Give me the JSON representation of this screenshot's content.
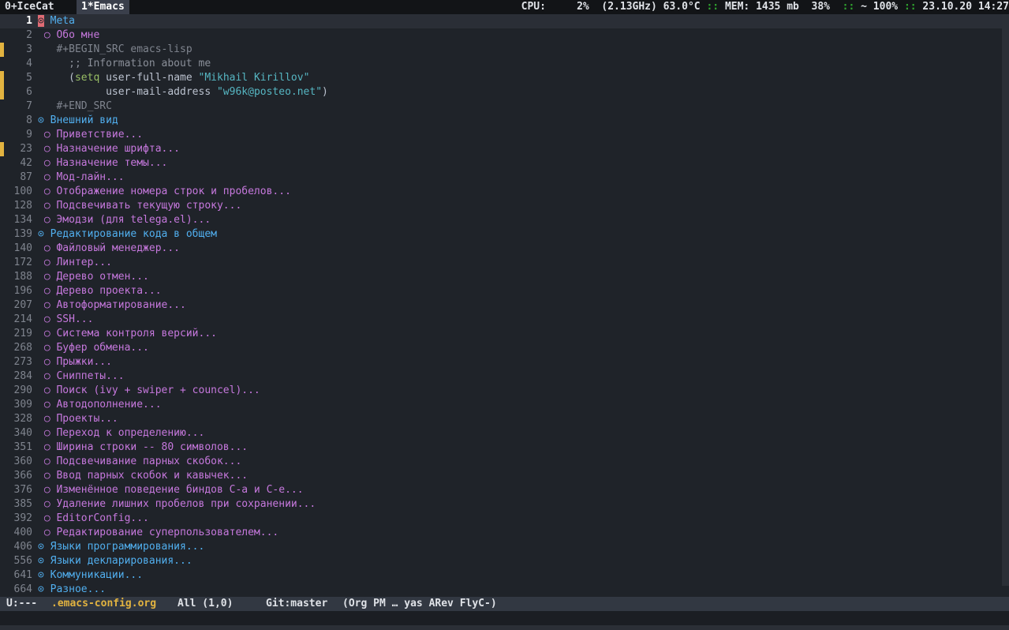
{
  "topbar": {
    "workspaces": [
      {
        "label": "0+IceCat",
        "active": false
      },
      {
        "label": "1*Emacs",
        "active": true
      }
    ],
    "status": {
      "cpu_label": "CPU:",
      "cpu_value": "2%",
      "cpu_freq": "(2.13GHz) 63.0°C",
      "sep1": "::",
      "mem_label": "MEM: 1435 mb",
      "mem_percent": "38%",
      "sep2": "::",
      "volume": "~ 100%",
      "sep3": "::",
      "datetime": "23.10.20 14:27"
    }
  },
  "editor": {
    "lines": [
      {
        "num": "1",
        "parts": [
          {
            "t": "⊙",
            "c": "cursor-bullet"
          },
          {
            "t": " Meta",
            "c": "h1"
          }
        ]
      },
      {
        "num": "2",
        "parts": [
          {
            "t": " ○ Обо мне",
            "c": "h2"
          }
        ]
      },
      {
        "num": "3",
        "parts": [
          {
            "t": "   #+BEGIN_SRC emacs-lisp",
            "c": "src"
          }
        ]
      },
      {
        "num": "4",
        "parts": [
          {
            "t": "     ;; Information about me",
            "c": "comment"
          }
        ]
      },
      {
        "num": "5",
        "parts": [
          {
            "t": "     (",
            "c": ""
          },
          {
            "t": "setq",
            "c": "kw"
          },
          {
            "t": " user-full-name ",
            "c": ""
          },
          {
            "t": "\"Mikhail Kirillov\"",
            "c": "str"
          }
        ]
      },
      {
        "num": "6",
        "parts": [
          {
            "t": "           user-mail-address ",
            "c": ""
          },
          {
            "t": "\"w96k@posteo.net\"",
            "c": "str"
          },
          {
            "t": ")",
            "c": ""
          }
        ]
      },
      {
        "num": "7",
        "parts": [
          {
            "t": "   #+END_SRC",
            "c": "src"
          }
        ]
      },
      {
        "num": "8",
        "parts": [
          {
            "t": "⊙ Внешний вид",
            "c": "h1"
          }
        ]
      },
      {
        "num": "9",
        "parts": [
          {
            "t": " ○ Приветствие...",
            "c": "h2"
          }
        ]
      },
      {
        "num": "23",
        "parts": [
          {
            "t": " ○ Назначение шрифта...",
            "c": "h2"
          }
        ]
      },
      {
        "num": "42",
        "parts": [
          {
            "t": " ○ Назначение темы...",
            "c": "h2"
          }
        ]
      },
      {
        "num": "87",
        "parts": [
          {
            "t": " ○ Мод-лайн...",
            "c": "h2"
          }
        ]
      },
      {
        "num": "100",
        "parts": [
          {
            "t": " ○ Отображение номера строк и пробелов...",
            "c": "h2"
          }
        ]
      },
      {
        "num": "128",
        "parts": [
          {
            "t": " ○ Подсвечивать текущую строку...",
            "c": "h2"
          }
        ]
      },
      {
        "num": "134",
        "parts": [
          {
            "t": " ○ Эмодзи (для telega.el)...",
            "c": "h2"
          }
        ]
      },
      {
        "num": "139",
        "parts": [
          {
            "t": "⊙ Редактирование кода в общем",
            "c": "h1"
          }
        ]
      },
      {
        "num": "140",
        "parts": [
          {
            "t": " ○ Файловый менеджер...",
            "c": "h2"
          }
        ]
      },
      {
        "num": "172",
        "parts": [
          {
            "t": " ○ Линтер...",
            "c": "h2"
          }
        ]
      },
      {
        "num": "188",
        "parts": [
          {
            "t": " ○ Дерево отмен...",
            "c": "h2"
          }
        ]
      },
      {
        "num": "196",
        "parts": [
          {
            "t": " ○ Дерево проекта...",
            "c": "h2"
          }
        ]
      },
      {
        "num": "207",
        "parts": [
          {
            "t": " ○ Автоформатирование...",
            "c": "h2"
          }
        ]
      },
      {
        "num": "214",
        "parts": [
          {
            "t": " ○ SSH...",
            "c": "h2"
          }
        ]
      },
      {
        "num": "219",
        "parts": [
          {
            "t": " ○ Система контроля версий...",
            "c": "h2"
          }
        ]
      },
      {
        "num": "268",
        "parts": [
          {
            "t": " ○ Буфер обмена...",
            "c": "h2"
          }
        ]
      },
      {
        "num": "273",
        "parts": [
          {
            "t": " ○ Прыжки...",
            "c": "h2"
          }
        ]
      },
      {
        "num": "284",
        "parts": [
          {
            "t": " ○ Сниппеты...",
            "c": "h2"
          }
        ]
      },
      {
        "num": "290",
        "parts": [
          {
            "t": " ○ Поиск (ivy + swiper + councel)...",
            "c": "h2"
          }
        ]
      },
      {
        "num": "309",
        "parts": [
          {
            "t": " ○ Автодополнение...",
            "c": "h2"
          }
        ]
      },
      {
        "num": "328",
        "parts": [
          {
            "t": " ○ Проекты...",
            "c": "h2"
          }
        ]
      },
      {
        "num": "340",
        "parts": [
          {
            "t": " ○ Переход к определению...",
            "c": "h2"
          }
        ]
      },
      {
        "num": "351",
        "parts": [
          {
            "t": " ○ Ширина строки -- 80 символов...",
            "c": "h2"
          }
        ]
      },
      {
        "num": "360",
        "parts": [
          {
            "t": " ○ Подсвечивание парных скобок...",
            "c": "h2"
          }
        ]
      },
      {
        "num": "366",
        "parts": [
          {
            "t": " ○ Ввод парных скобок и кавычек...",
            "c": "h2"
          }
        ]
      },
      {
        "num": "376",
        "parts": [
          {
            "t": " ○ Изменённое поведение биндов C-a и C-e...",
            "c": "h2"
          }
        ]
      },
      {
        "num": "385",
        "parts": [
          {
            "t": " ○ Удаление лишних пробелов при сохранении...",
            "c": "h2"
          }
        ]
      },
      {
        "num": "392",
        "parts": [
          {
            "t": " ○ EditorConfig...",
            "c": "h2"
          }
        ]
      },
      {
        "num": "400",
        "parts": [
          {
            "t": " ○ Редактирование суперпользователем...",
            "c": "h2"
          }
        ]
      },
      {
        "num": "406",
        "parts": [
          {
            "t": "⊙ Языки программирования...",
            "c": "h1"
          }
        ]
      },
      {
        "num": "556",
        "parts": [
          {
            "t": "⊙ Языки декларирования...",
            "c": "h1"
          }
        ]
      },
      {
        "num": "641",
        "parts": [
          {
            "t": "⊙ Коммуникации...",
            "c": "h1"
          }
        ]
      },
      {
        "num": "664",
        "parts": [
          {
            "t": "⊙ Разное...",
            "c": "h1"
          }
        ]
      }
    ],
    "current_line": "1",
    "fringe_marked_lines": [
      "3",
      "5",
      "6",
      "23"
    ]
  },
  "modeline": {
    "state": "U:---",
    "buffer": ".emacs-config.org",
    "position": "All (1,0)",
    "vc": "Git:master",
    "modes": "(Org PM … yas ARev FlyC-)"
  },
  "colors": {
    "background": "#1f2329",
    "heading1": "#51afef",
    "heading2": "#c678dd",
    "string": "#56b6c2",
    "keyword": "#98be65",
    "fringe_mark": "#e2b340",
    "status_separator": "#2fa32f"
  }
}
